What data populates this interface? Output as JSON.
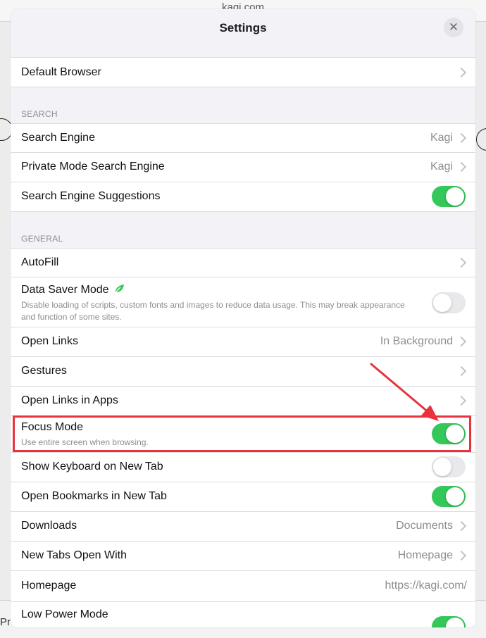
{
  "background": {
    "url_text": "kagi.com",
    "left_text": "Pr"
  },
  "header": {
    "title": "Settings"
  },
  "rows": {
    "default_browser": "Default Browser",
    "search_engine": {
      "label": "Search Engine",
      "value": "Kagi"
    },
    "private_search_engine": {
      "label": "Private Mode Search Engine",
      "value": "Kagi"
    },
    "search_suggestions": {
      "label": "Search Engine Suggestions",
      "on": true
    },
    "autofill": "AutoFill",
    "data_saver": {
      "label": "Data Saver Mode",
      "sub": "Disable loading of scripts, custom fonts and images to reduce data usage. This may break appearance and function of some sites.",
      "on": false
    },
    "open_links": {
      "label": "Open Links",
      "value": "In Background"
    },
    "gestures": "Gestures",
    "open_links_in_apps": "Open Links in Apps",
    "focus_mode": {
      "label": "Focus Mode",
      "sub": "Use entire screen when browsing.",
      "on": true
    },
    "show_keyboard": {
      "label": "Show Keyboard on New Tab",
      "on": false
    },
    "open_bookmarks": {
      "label": "Open Bookmarks in New Tab",
      "on": true
    },
    "downloads": {
      "label": "Downloads",
      "value": "Documents"
    },
    "new_tabs_open_with": {
      "label": "New Tabs Open With",
      "value": "Homepage"
    },
    "homepage": {
      "label": "Homepage",
      "value": "https://kagi.com/"
    },
    "low_power": {
      "label": "Low Power Mode",
      "on": true
    }
  },
  "sections": {
    "search": "SEARCH",
    "general": "GENERAL"
  },
  "colors": {
    "toggle_on": "#34c759",
    "annotation": "#e8323c",
    "leaf_icon": "#34c759"
  }
}
